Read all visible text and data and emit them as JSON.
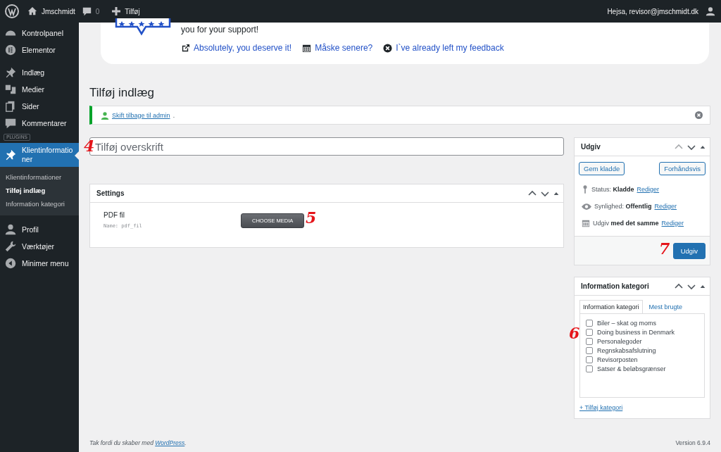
{
  "admin_bar": {
    "site": "Jmschmidt",
    "comments": "0",
    "new": "Tilføj",
    "greeting": "Hejsa, revisor@jmschmidt.dk"
  },
  "sidebar": {
    "items": [
      {
        "label": "Kontrolpanel",
        "selected": false
      },
      {
        "label": "Elementor",
        "selected": false
      },
      {
        "label": "Indlæg",
        "selected": false
      },
      {
        "label": "Medier",
        "selected": false
      },
      {
        "label": "Sider",
        "selected": false
      },
      {
        "label": "Kommentarer",
        "selected": false
      },
      {
        "label": "Klientinformationer",
        "selected": true,
        "group_label": "PLUGINS",
        "children": [
          {
            "label": "Klientinformationer",
            "selected": false
          },
          {
            "label": "Tilføj indlæg",
            "selected": true
          },
          {
            "label": "Information kategori",
            "selected": false
          }
        ]
      },
      {
        "label": "Profil",
        "selected": false
      },
      {
        "label": "Værktøjer",
        "selected": false
      },
      {
        "label": "Minimer menu",
        "selected": false
      }
    ]
  },
  "review_notice": {
    "text": "you for your support!",
    "links": [
      "Absolutely, you deserve it!",
      "Måske senere?",
      "I`ve already left my feedback"
    ]
  },
  "page_title": "Tilføj indlæg",
  "switch_notice": {
    "link": "Skift tilbage til admin",
    "suffix": "."
  },
  "title_field": {
    "placeholder": "Tilføj overskrift",
    "annotation": "4"
  },
  "settings_box": {
    "title": "Settings",
    "field_label": "PDF fil",
    "field_name": "Name: pdf_fil",
    "button": "CHOOSE MEDIA",
    "annotation": "5"
  },
  "publish_box": {
    "title": "Udgiv",
    "save_draft": "Gem kladde",
    "preview": "Forhåndsvis",
    "rows": [
      {
        "label": "Status:",
        "value": "Kladde",
        "link": "Rediger"
      },
      {
        "label": "Synlighed:",
        "value": "Offentlig",
        "link": "Rediger"
      },
      {
        "label": "Udgiv",
        "value": "med det samme",
        "link": "Rediger"
      }
    ],
    "publish": "Udgiv",
    "annotation": "7"
  },
  "category_box": {
    "title": "Information kategori",
    "tabs": [
      {
        "label": "Information kategori",
        "selected": true
      },
      {
        "label": "Mest brugte",
        "selected": false
      }
    ],
    "categories": [
      {
        "label": "Biler – skat og moms",
        "checked": false
      },
      {
        "label": "Doing business in Denmark",
        "checked": false
      },
      {
        "label": "Personalegoder",
        "checked": false
      },
      {
        "label": "Regnskabsafslutning",
        "checked": false
      },
      {
        "label": "Revisorposten",
        "checked": false
      },
      {
        "label": "Satser & beløbsgrænser",
        "checked": false
      }
    ],
    "add_link": "+ Tilføj kategori",
    "annotation": "6"
  },
  "footer": {
    "thanks": "Tak fordi du skaber med",
    "link": "WordPress",
    "suffix": ".",
    "version": "Version 6.9.4"
  }
}
